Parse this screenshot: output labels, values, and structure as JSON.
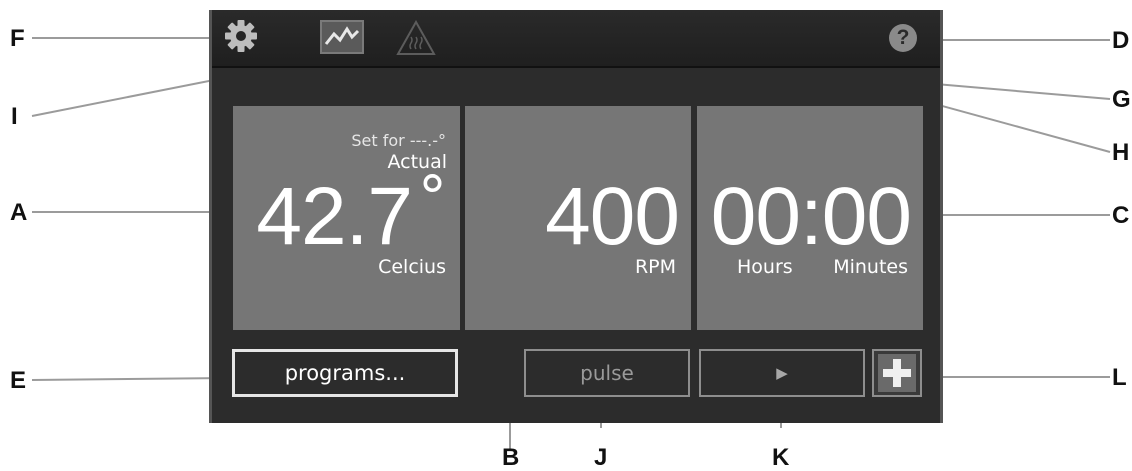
{
  "callouts": {
    "F": "F",
    "I": "I",
    "A": "A",
    "E": "E",
    "B": "B",
    "J": "J",
    "K": "K",
    "L": "L",
    "C": "C",
    "H": "H",
    "G": "G",
    "D": "D"
  },
  "topbar": {
    "icons": [
      "gear-icon",
      "graph-icon",
      "heater-warning-icon",
      "help-icon"
    ],
    "help_glyph": "?"
  },
  "temperature": {
    "set_for": "Set for ---.-°",
    "actual_label": "Actual",
    "value": "42.7",
    "degree_symbol": "°",
    "unit": "Celcius"
  },
  "speed": {
    "value": "400",
    "unit": "RPM"
  },
  "timer": {
    "value": "00:00",
    "hours_label": "Hours",
    "minutes_label": "Minutes"
  },
  "buttons": {
    "programs_label": "programs...",
    "pulse_label": "pulse",
    "start_glyph": "▶",
    "add_glyph": "+"
  },
  "colors": {
    "screen_bg": "#2c2c2c",
    "panel_bg": "#767676",
    "active_border": "#e6e6e6",
    "disabled_border": "#8e8e8e",
    "disabled_text": "#9a9a9a"
  }
}
